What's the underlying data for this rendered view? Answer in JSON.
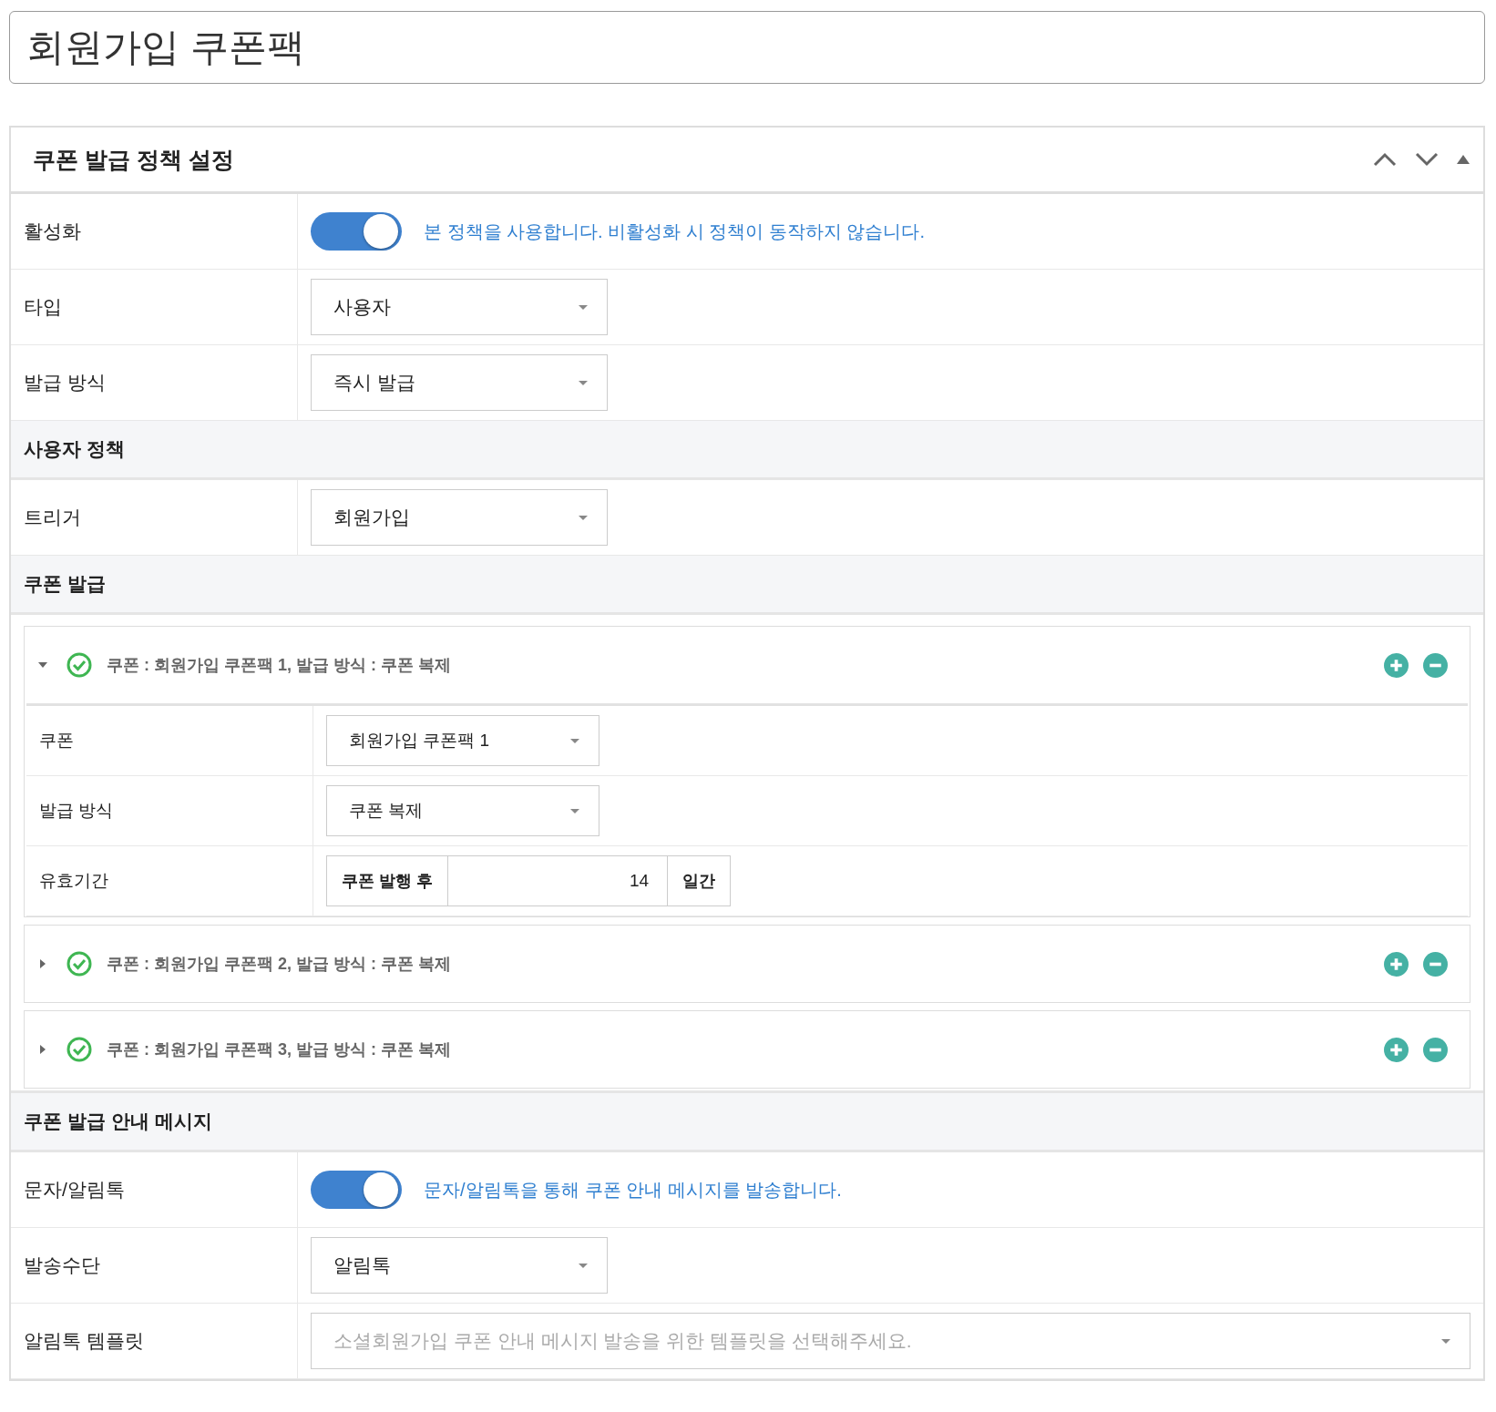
{
  "page_title": "회원가입 쿠폰팩",
  "panel": {
    "title": "쿠폰 발급 정책 설정",
    "rows": [
      {
        "kind": "toggle",
        "label": "활성화",
        "on": true,
        "description": "본 정책을 사용합니다. 비활성화 시 정책이 동작하지 않습니다."
      },
      {
        "kind": "select",
        "label": "타입",
        "value": "사용자"
      },
      {
        "kind": "select",
        "label": "발급 방식",
        "value": "즉시 발급"
      },
      {
        "kind": "section",
        "label": "사용자 정책"
      },
      {
        "kind": "select",
        "label": "트리거",
        "value": "회원가입"
      },
      {
        "kind": "section",
        "label": "쿠폰 발급"
      },
      {
        "kind": "coupons",
        "items": [
          {
            "summary": "쿠폰 : 회원가입 쿠폰팩 1, 발급 방식 : 쿠폰 복제",
            "expanded": true,
            "fields": [
              {
                "kind": "select",
                "label": "쿠폰",
                "value": "회원가입 쿠폰팩 1"
              },
              {
                "kind": "select",
                "label": "발급 방식",
                "value": "쿠폰 복제"
              },
              {
                "kind": "period",
                "label": "유효기간",
                "prefix": "쿠폰 발행 후",
                "value": "14",
                "suffix": "일간"
              }
            ]
          },
          {
            "summary": "쿠폰 : 회원가입 쿠폰팩 2, 발급 방식 : 쿠폰 복제",
            "expanded": false
          },
          {
            "summary": "쿠폰 : 회원가입 쿠폰팩 3, 발급 방식 : 쿠폰 복제",
            "expanded": false
          }
        ]
      },
      {
        "kind": "section",
        "label": "쿠폰 발급 안내 메시지"
      },
      {
        "kind": "toggle",
        "label": "문자/알림톡",
        "on": true,
        "description": "문자/알림톡을 통해 쿠폰 안내 메시지를 발송합니다."
      },
      {
        "kind": "select",
        "label": "발송수단",
        "value": "알림톡"
      },
      {
        "kind": "wide_select",
        "label": "알림톡 템플릿",
        "placeholder": "소셜회원가입 쿠폰 안내 메시지 발송을 위한 템플릿을 선택해주세요."
      }
    ]
  }
}
